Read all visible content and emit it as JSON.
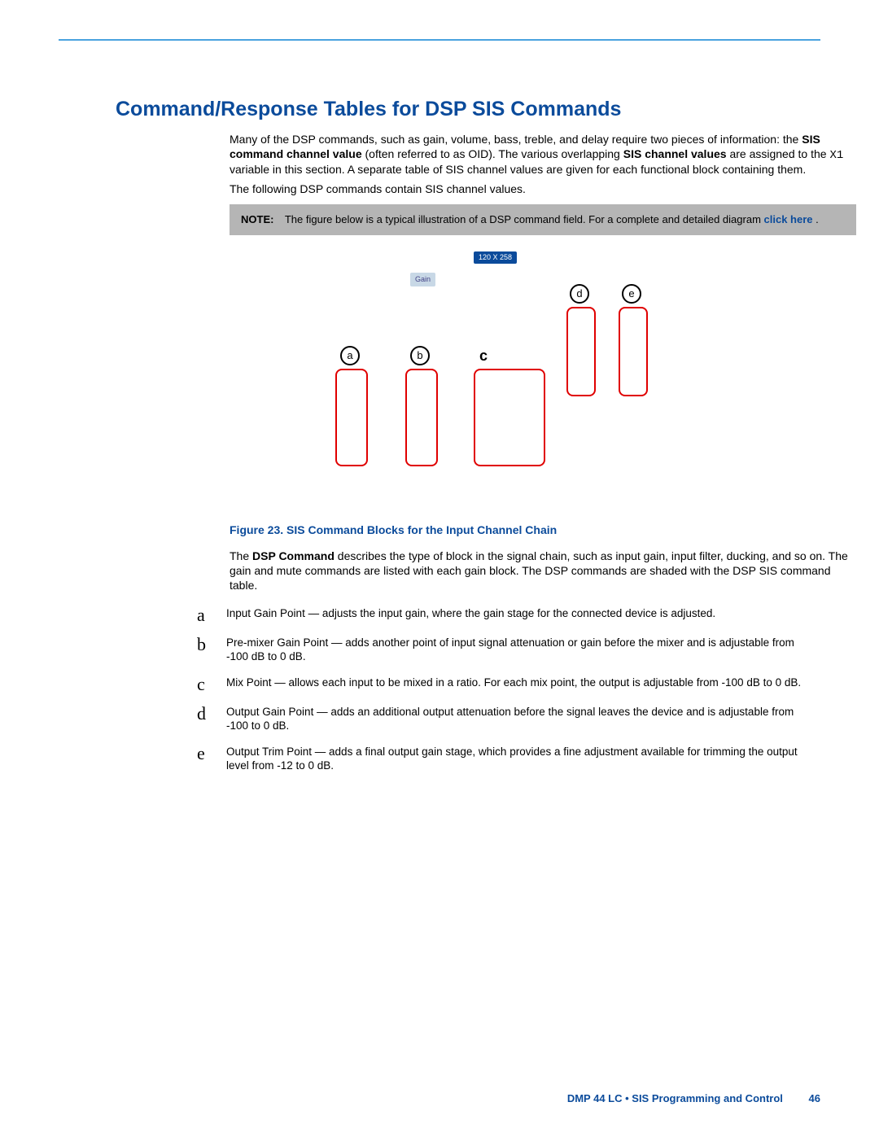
{
  "heading": "Command/Response Tables for DSP SIS Commands",
  "para1a": "Many of the DSP commands, such as gain, volume, bass, treble, and delay require two pieces of information: the ",
  "para1b": "SIS command channel value ",
  "para1c": "(often referred to as OID). The various overlapping ",
  "para1d": "SIS channel values ",
  "para1e": "are assigned to the ",
  "para1var": "X1",
  "para1f": " variable in this section. A separate table of SIS channel values are given for each functional block containing them.",
  "para2a": "The following DSP commands contain SIS channel values.",
  "note_label": "NOTE:",
  "note_text1": "The figure below is a typical illustration of a DSP command field. For a complete and detailed diagram ",
  "note_link": "click here",
  "note_text2": ".",
  "gain_label": "Gain",
  "dim_label": "120 X 258",
  "circle_a": "a",
  "circle_b": "b",
  "circle_c": "c",
  "circle_d": "d",
  "circle_e": "e",
  "figure_label": "Figure 23.",
  "figure_caption": " SIS Command Blocks for the Input Channel Chain",
  "after_fig_a": "The ",
  "after_fig_b": "DSP Command",
  "after_fig_c": " describes the type of block in the signal chain, such as input gain, input filter, ducking, and so on. The gain and mute commands are listed with each gain block. The DSP commands are shaded with the DSP SIS command table.",
  "items": {
    "a": {
      "letter": "a",
      "text": "Input Gain Point — adjusts the input gain, where the gain stage for the connected device is adjusted."
    },
    "b": {
      "letter": "b",
      "text": "Pre-mixer Gain Point — adds another point of input signal attenuation or gain before the mixer and is adjustable from -100 dB to 0 dB."
    },
    "c": {
      "letter": "c",
      "text": "Mix Point — allows each input to be mixed in a ratio. For each mix point, the output is adjustable from -100 dB to 0 dB."
    },
    "d": {
      "letter": "d",
      "text": "Output Gain Point — adds an additional output attenuation before the signal leaves the device and is adjustable from -100 to 0 dB."
    },
    "e": {
      "letter": "e",
      "text": "Output Trim Point — adds a final output gain stage, which provides a fine adjustment available for trimming the output level from -12 to 0 dB."
    }
  },
  "footer_text": "DMP 44 LC • SIS Programming and Control",
  "footer_page": "46"
}
